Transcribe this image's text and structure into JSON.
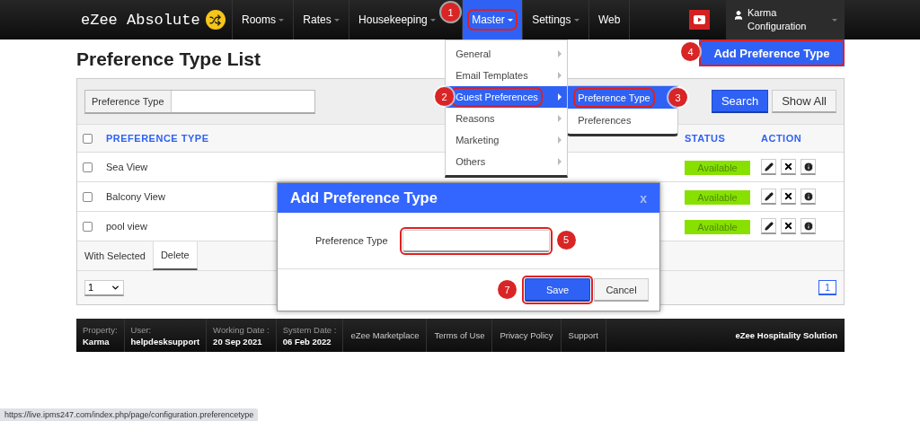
{
  "navbar": {
    "logo": "eZee Absolute",
    "items": [
      {
        "label": "Rooms",
        "has_caret": true,
        "selected": false
      },
      {
        "label": "Rates",
        "has_caret": true,
        "selected": false
      },
      {
        "label": "Housekeeping",
        "has_caret": true,
        "selected": false
      },
      {
        "label": "Master",
        "has_caret": true,
        "selected": true,
        "callout": "1"
      },
      {
        "label": "Settings",
        "has_caret": true,
        "selected": false
      },
      {
        "label": "Web",
        "has_caret": false,
        "selected": false
      }
    ],
    "user": {
      "name": "Karma",
      "role": "Configuration"
    }
  },
  "master_menu": {
    "items": [
      {
        "label": "General",
        "selected": false
      },
      {
        "label": "Email Templates",
        "selected": false
      },
      {
        "label": "Guest Preferences",
        "selected": true,
        "callout": "2"
      },
      {
        "label": "Reasons",
        "selected": false
      },
      {
        "label": "Marketing",
        "selected": false
      },
      {
        "label": "Others",
        "selected": false
      }
    ]
  },
  "submenu": {
    "items": [
      {
        "label": "Preference Type",
        "selected": true,
        "callout": "3"
      },
      {
        "label": "Preferences",
        "selected": false
      }
    ]
  },
  "page": {
    "title": "Preference Type List",
    "add_button": {
      "label": "Add Preference Type",
      "callout": "4"
    }
  },
  "filter": {
    "label": "Preference Type",
    "buttons": [
      {
        "label": "Search",
        "kind": "primary"
      },
      {
        "label": "Show All",
        "kind": "secondary"
      }
    ]
  },
  "table": {
    "columns": [
      "PREFERENCE TYPE",
      "STATUS",
      "ACTION"
    ],
    "all_checked": false,
    "rows": [
      {
        "name": "Sea View",
        "checked": false,
        "status": "Available"
      },
      {
        "name": "Balcony View",
        "checked": false,
        "status": "Available"
      },
      {
        "name": "pool view",
        "checked": false,
        "status": "Available"
      }
    ]
  },
  "bulk_actions": {
    "label": "With Selected",
    "actions": [
      "Delete"
    ]
  },
  "pagination": {
    "page_size": "1",
    "pages": [
      {
        "label": "1",
        "selected": true
      }
    ]
  },
  "dialog": {
    "title": "Add Preference Type",
    "close": "x",
    "field": {
      "label": "Preference Type",
      "callout": "5"
    },
    "buttons": [
      {
        "label": "Save",
        "kind": "primary",
        "callout": "7"
      },
      {
        "label": "Cancel",
        "kind": "secondary"
      }
    ]
  },
  "footer": {
    "info": [
      {
        "label": "Property:",
        "value": "Karma"
      },
      {
        "label": "User:",
        "value": "helpdesksupport"
      },
      {
        "label": "Working Date :",
        "value": "20 Sep 2021"
      },
      {
        "label": "System Date :",
        "value": "06 Feb 2022"
      }
    ],
    "links": [
      "eZee Marketplace",
      "Terms of Use",
      "Privacy Policy",
      "Support"
    ],
    "brand": "eZee Hospitality Solution"
  },
  "status_url": "https://live.ipms247.com/index.php/page/configuration.preferencetype"
}
